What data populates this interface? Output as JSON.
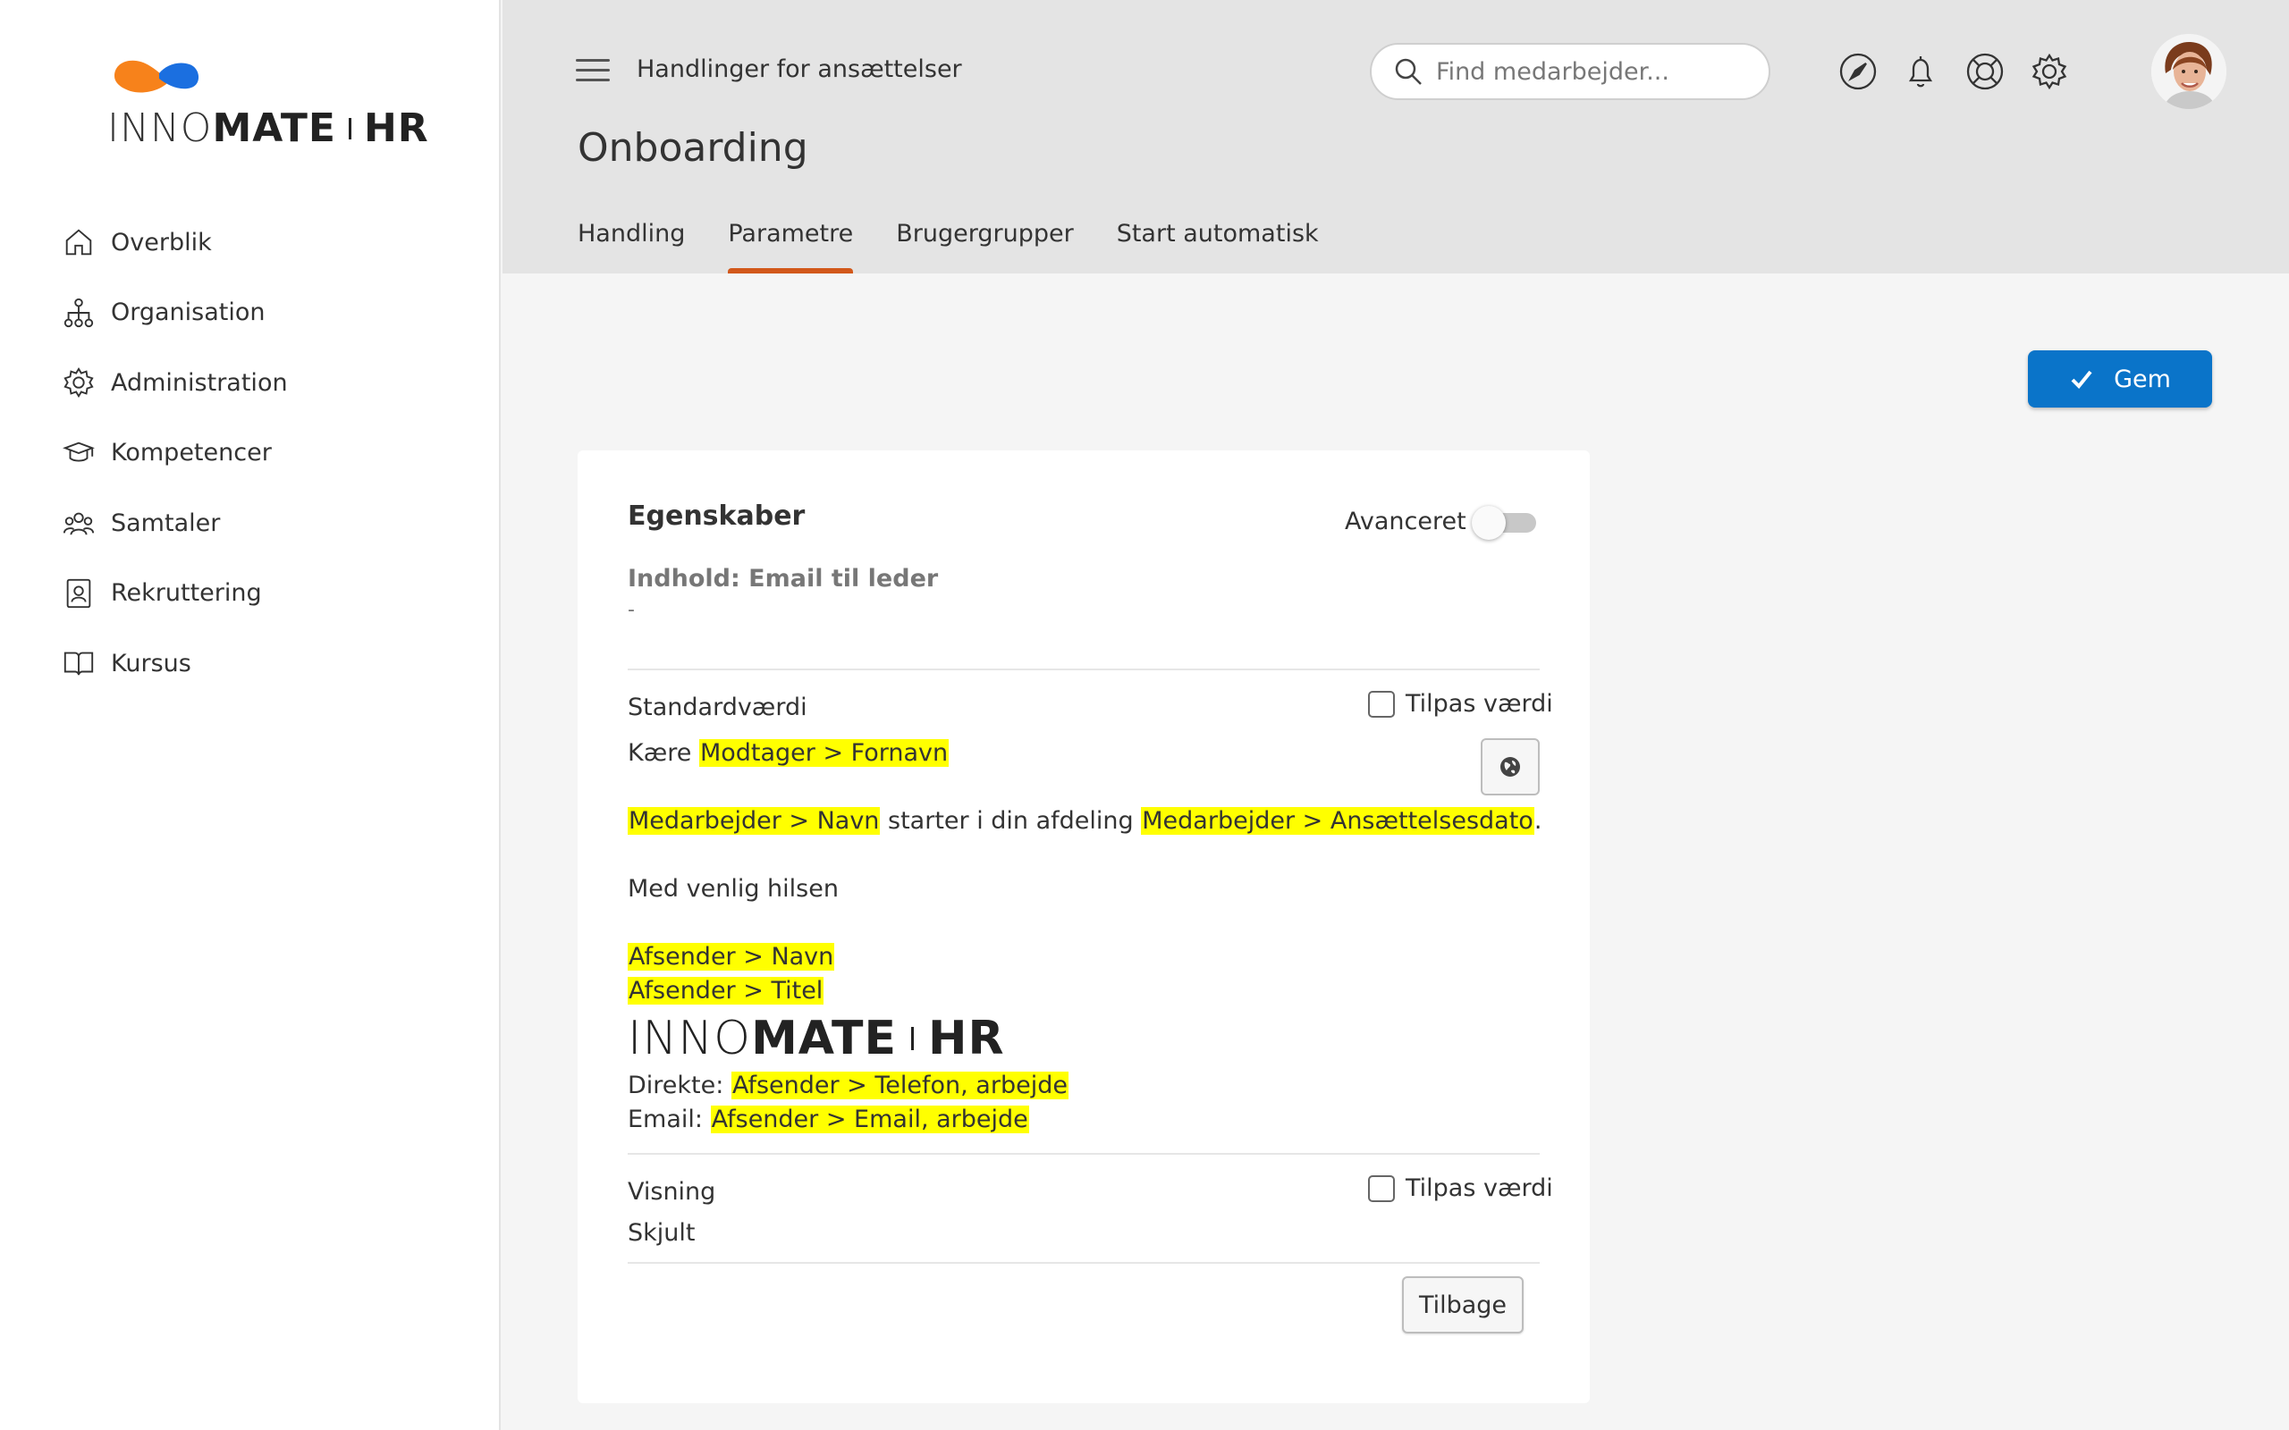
{
  "brand": {
    "name_thin": "INNO",
    "name_bold": "MATE",
    "suffix": "HR",
    "colors": {
      "orange": "#f7821b",
      "blue": "#1b6fe0",
      "accent": "#d2581a",
      "primary_button": "#0a74c9",
      "highlight": "#ffff00"
    }
  },
  "sidebar": {
    "items": [
      {
        "label": "Overblik",
        "icon": "home-icon"
      },
      {
        "label": "Organisation",
        "icon": "org-chart-icon"
      },
      {
        "label": "Administration",
        "icon": "gear-icon"
      },
      {
        "label": "Kompetencer",
        "icon": "graduation-cap-icon"
      },
      {
        "label": "Samtaler",
        "icon": "people-icon"
      },
      {
        "label": "Rekruttering",
        "icon": "id-badge-icon"
      },
      {
        "label": "Kursus",
        "icon": "book-icon"
      }
    ]
  },
  "header": {
    "breadcrumb": "Handlinger for ansættelser",
    "title": "Onboarding",
    "search_placeholder": "Find medarbejder...",
    "tabs": [
      {
        "label": "Handling",
        "active": false
      },
      {
        "label": "Parametre",
        "active": true
      },
      {
        "label": "Brugergrupper",
        "active": false
      },
      {
        "label": "Start automatisk",
        "active": false
      }
    ],
    "icons": [
      "navigation-icon",
      "bell-icon",
      "help-lifebuoy-icon",
      "settings-gear-icon"
    ]
  },
  "actions": {
    "save_label": "Gem"
  },
  "card": {
    "title": "Egenskaber",
    "advanced_label": "Avanceret",
    "advanced_on": false,
    "content_label": "Indhold: Email til leder",
    "content_value": "-",
    "standard": {
      "label": "Standardværdi",
      "customize_label": "Tilpas værdi",
      "email": {
        "greeting": "Kære",
        "recipient_first_name": "Modtager > Fornavn",
        "employee_name": "Medarbejder > Navn",
        "starts_text": "starter i din afdeling",
        "employment_date": "Medarbejder > Ansættelsesdato",
        "period": ".",
        "regards": "Med venlig hilsen",
        "sender_name": "Afsender > Navn",
        "sender_title": "Afsender > Titel",
        "direct_label": "Direkte:",
        "sender_phone": "Afsender > Telefon, arbejde",
        "email_label": "Email:",
        "sender_email": "Afsender > Email, arbejde"
      }
    },
    "display": {
      "label": "Visning",
      "customize_label": "Tilpas værdi",
      "value": "Skjult"
    },
    "back_label": "Tilbage"
  }
}
